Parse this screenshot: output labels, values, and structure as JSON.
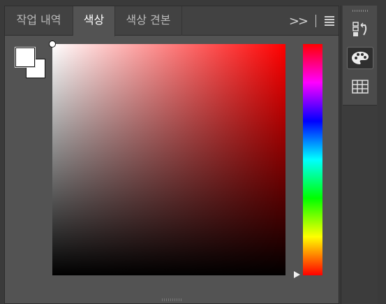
{
  "tabs": [
    {
      "label": "작업 내역",
      "active": false
    },
    {
      "label": "색상",
      "active": true
    },
    {
      "label": "색상 견본",
      "active": false
    }
  ],
  "tab_actions": {
    "overflow_label": ">>"
  },
  "colors": {
    "foreground": "#ffffff",
    "background": "#ffffff",
    "hue_selected": "#ff0000",
    "panel_bg": "#535353",
    "tabbar_bg": "#424242"
  },
  "picker": {
    "hue_degrees": 0
  },
  "dock": {
    "icons": [
      "history-icon",
      "color-palette-icon",
      "swatches-grid-icon"
    ],
    "active_icon": "color-palette-icon"
  }
}
